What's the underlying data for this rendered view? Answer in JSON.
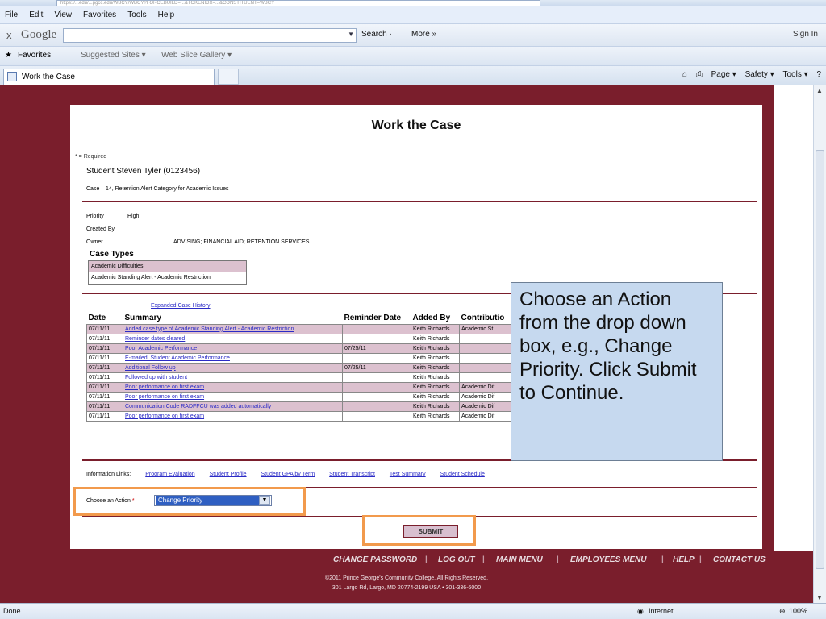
{
  "browser": {
    "url": "https://...edu/...pgcc.edu/WBCY/WBCY?FORCEBUILD=...&TOKENIDX=...&CONSTITUENT=WBCY",
    "menu": [
      "File",
      "Edit",
      "View",
      "Favorites",
      "Tools",
      "Help"
    ],
    "google": {
      "close": "x",
      "logo": "Google",
      "search_label": "Search ·",
      "more_label": "More »",
      "sign_in": "Sign In"
    },
    "favorites": {
      "label": "Favorites",
      "suggested": "Suggested Sites ▾",
      "gallery": "Web Slice Gallery ▾"
    },
    "tab": {
      "title": "Work the Case"
    },
    "commands": [
      "Page ▾",
      "Safety ▾",
      "Tools ▾"
    ]
  },
  "page": {
    "title": "Work the Case",
    "required_note": "* = Required",
    "student": "Student  Steven Tyler (0123456)",
    "case_label": "Case",
    "case_value": "14, Retention Alert Category for Academic Issues",
    "priority_label": "Priority",
    "priority_value": "High",
    "created_by_label": "Created By",
    "owner_label": "Owner",
    "owner_value": "ADVISING; FINANCIAL AID; RETENTION SERVICES",
    "case_types_heading": "Case Types",
    "case_types": [
      "Academic Difficulties",
      "Academic Standing Alert - Academic Restriction"
    ],
    "expanded_link": "Expanded Case History",
    "history_headers": [
      "Date",
      "Summary",
      "Reminder Date",
      "Added By",
      "Contributio"
    ],
    "history_rows": [
      {
        "date": "07/11/11",
        "summary": "Added case type of Academic Standing Alert - Academic Restriction",
        "reminder": "",
        "added_by": "Keith Richards",
        "contrib": "Academic St"
      },
      {
        "date": "07/11/11",
        "summary": "Reminder dates cleared",
        "reminder": "",
        "added_by": "Keith Richards",
        "contrib": ""
      },
      {
        "date": "07/11/11",
        "summary": "Poor Academic Performance",
        "reminder": "07/25/11",
        "added_by": "Keith Richards",
        "contrib": ""
      },
      {
        "date": "07/11/11",
        "summary": "E-mailed: Student Academic Performance",
        "reminder": "",
        "added_by": "Keith Richards",
        "contrib": ""
      },
      {
        "date": "07/11/11",
        "summary": "Additional Follow up",
        "reminder": "07/25/11",
        "added_by": "Keith Richards",
        "contrib": ""
      },
      {
        "date": "07/11/11",
        "summary": "Followed up with student",
        "reminder": "",
        "added_by": "Keith Richards",
        "contrib": ""
      },
      {
        "date": "07/11/11",
        "summary": "Poor performance on first exam",
        "reminder": "",
        "added_by": "Keith Richards",
        "contrib": "Academic Dif"
      },
      {
        "date": "07/11/11",
        "summary": "Poor performance on first exam",
        "reminder": "",
        "added_by": "Keith Richards",
        "contrib": "Academic Dif"
      },
      {
        "date": "07/11/11",
        "summary": "Communication Code RADFFCU was added automatically",
        "reminder": "",
        "added_by": "Keith Richards",
        "contrib": "Academic Dif"
      },
      {
        "date": "07/11/11",
        "summary": "Poor performance on first exam",
        "reminder": "",
        "added_by": "Keith Richards",
        "contrib": "Academic Dif"
      }
    ],
    "info_links_label": "Information Links:",
    "info_links": [
      "Program Evaluation",
      "Student Profile",
      "Student GPA by Term",
      "Student Transcript",
      "Test Summary",
      "Student Schedule"
    ],
    "action_label": "Choose an Action",
    "action_required_mark": "*",
    "action_selected": "Change Priority",
    "submit_label": "SUBMIT"
  },
  "annotation": {
    "text": "Choose an Action from the drop down box, e.g., Change Priority. Click Submit to Continue."
  },
  "footer": {
    "nav": [
      "CHANGE PASSWORD",
      "LOG OUT",
      "MAIN MENU",
      "EMPLOYEES MENU",
      "HELP",
      "CONTACT US"
    ],
    "copyright": "©2011 Prince George's Community College. All Rights Reserved.",
    "address": "301 Largo Rd, Largo, MD 20774-2199 USA • 301-336-6000"
  },
  "status": {
    "left": "Done",
    "zone": "Internet",
    "zoom": "100%"
  },
  "colors": {
    "brand": "#7a1e2c",
    "row_alt": "#dcc1cf",
    "callout_border": "#f29a4c",
    "note_bg": "#c6d9ef",
    "link": "#2b2bc6"
  }
}
